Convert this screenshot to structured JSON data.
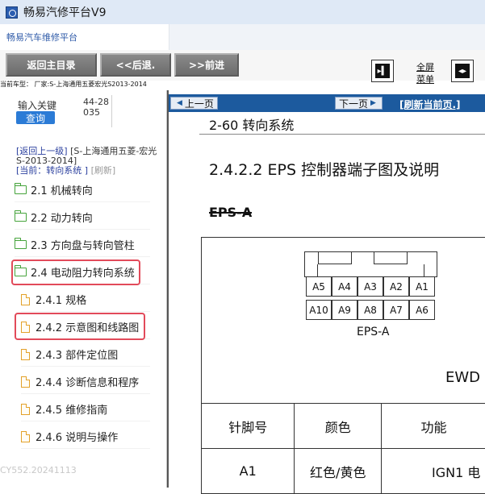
{
  "window": {
    "title": "畅易汽修平台V9"
  },
  "addressbar": {
    "tab_label": "畅易汽车维修平台"
  },
  "toolbar": {
    "home_label": "返回主目录",
    "back_label": "<<后退.",
    "forward_label": ">>前进",
    "fullscreen_line1": "全屏",
    "fullscreen_line2": "菜单"
  },
  "vehicle_info": "当前车型： 厂家:S-上海通用五菱宏光S2013-2014",
  "sidebar": {
    "keyword_label": "输入关键",
    "keyword_value": "44-28035",
    "query_label": "查询",
    "back_link": "[返回上一级]",
    "breadcrumb": "[S-上海通用五菱-宏光S-2013-2014]",
    "current_label": "[当前：转向系统 ]",
    "refresh_label": "[刷新]",
    "items": [
      {
        "label": "2.1 机械转向"
      },
      {
        "label": "2.2 动力转向"
      },
      {
        "label": "2.3 方向盘与转向管柱"
      },
      {
        "label": "2.4 电动阻力转向系统"
      },
      {
        "label": "2.4.1 规格"
      },
      {
        "label": "2.4.2 示意图和线路图"
      },
      {
        "label": "2.4.3 部件定位图"
      },
      {
        "label": "2.4.4 诊断信息和程序"
      },
      {
        "label": "2.4.5 维修指南"
      },
      {
        "label": "2.4.6 说明与操作"
      }
    ],
    "watermark": "CY552.20241113"
  },
  "document": {
    "prev_label": "上一页",
    "next_label": "下一页",
    "refresh_label": "[刷新当前页.]",
    "section": "2-60 转向系统",
    "heading": "2.4.2.2 EPS 控制器端子图及说明",
    "connector_title": "EPS-A",
    "connector_caption": "EPS-A",
    "pins_row1": [
      "A5",
      "A4",
      "A3",
      "A2",
      "A1"
    ],
    "pins_row2": [
      "A10",
      "A9",
      "A8",
      "A7",
      "A6"
    ],
    "ewd_label": "EWD",
    "table_headers": [
      "针脚号",
      "颜色",
      "功能"
    ],
    "table_row1": [
      "A1",
      "红色/黄色",
      "IGN1 电"
    ]
  }
}
